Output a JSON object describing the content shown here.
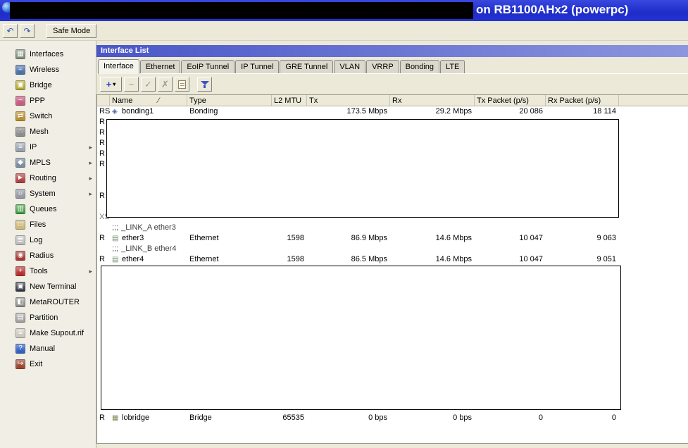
{
  "titlebar": {
    "title": "on RB1100AHx2 (powerpc)"
  },
  "toolbar": {
    "undo_label": "↶",
    "redo_label": "↷",
    "safe_mode_label": "Safe Mode"
  },
  "sidebar": {
    "items": [
      {
        "label": "Interfaces",
        "icon": "interfaces-icon",
        "glyph": "▦",
        "color": "#7E8F7E",
        "submenu": false
      },
      {
        "label": "Wireless",
        "icon": "wireless-icon",
        "glyph": "≈",
        "color": "#4A6FA8",
        "submenu": false
      },
      {
        "label": "Bridge",
        "icon": "bridge-icon",
        "glyph": "▣",
        "color": "#B5A832",
        "submenu": false
      },
      {
        "label": "PPP",
        "icon": "ppp-icon",
        "glyph": "~",
        "color": "#C55B7E",
        "submenu": false
      },
      {
        "label": "Switch",
        "icon": "switch-icon",
        "glyph": "⇄",
        "color": "#B98E2F",
        "submenu": false
      },
      {
        "label": "Mesh",
        "icon": "mesh-icon",
        "glyph": "∴",
        "color": "#8B8B8B",
        "submenu": false
      },
      {
        "label": "IP",
        "icon": "ip-icon",
        "glyph": "≡",
        "color": "#9AA4AE",
        "submenu": true
      },
      {
        "label": "MPLS",
        "icon": "mpls-icon",
        "glyph": "◆",
        "color": "#7A8BA0",
        "submenu": true
      },
      {
        "label": "Routing",
        "icon": "routing-icon",
        "glyph": "►",
        "color": "#B04040",
        "submenu": true
      },
      {
        "label": "System",
        "icon": "system-icon",
        "glyph": "☼",
        "color": "#9598A2",
        "submenu": true
      },
      {
        "label": "Queues",
        "icon": "queues-icon",
        "glyph": "▥",
        "color": "#3F9A3F",
        "submenu": false
      },
      {
        "label": "Files",
        "icon": "files-icon",
        "glyph": "□",
        "color": "#CBB878",
        "submenu": false
      },
      {
        "label": "Log",
        "icon": "log-icon",
        "glyph": "≣",
        "color": "#BDBDBD",
        "submenu": false
      },
      {
        "label": "Radius",
        "icon": "radius-icon",
        "glyph": "◉",
        "color": "#A63232",
        "submenu": false
      },
      {
        "label": "Tools",
        "icon": "tools-icon",
        "glyph": "+",
        "color": "#B53030",
        "submenu": true
      },
      {
        "label": "New Terminal",
        "icon": "new-terminal-icon",
        "glyph": "▣",
        "color": "#2F3440",
        "submenu": false
      },
      {
        "label": "MetaROUTER",
        "icon": "metarouter-icon",
        "glyph": "◧",
        "color": "#8F8F8F",
        "submenu": false
      },
      {
        "label": "Partition",
        "icon": "partition-icon",
        "glyph": "▤",
        "color": "#9E9E9E",
        "submenu": false
      },
      {
        "label": "Make Supout.rif",
        "icon": "make-supout-icon",
        "glyph": "≡",
        "color": "#C9C9BE",
        "submenu": false
      },
      {
        "label": "Manual",
        "icon": "manual-icon",
        "glyph": "?",
        "color": "#2F5FBF",
        "submenu": false
      },
      {
        "label": "Exit",
        "icon": "exit-icon",
        "glyph": "↪",
        "color": "#9C4530",
        "submenu": false
      }
    ]
  },
  "window": {
    "title": "Interface List",
    "tabs": [
      {
        "label": "Interface",
        "active": true
      },
      {
        "label": "Ethernet",
        "active": false
      },
      {
        "label": "EoIP Tunnel",
        "active": false
      },
      {
        "label": "IP Tunnel",
        "active": false
      },
      {
        "label": "GRE Tunnel",
        "active": false
      },
      {
        "label": "VLAN",
        "active": false
      },
      {
        "label": "VRRP",
        "active": false
      },
      {
        "label": "Bonding",
        "active": false
      },
      {
        "label": "LTE",
        "active": false
      }
    ],
    "action_buttons": {
      "add_label": "+",
      "add_caret": "▾",
      "remove_label": "−",
      "enable_label": "✓",
      "disable_label": "✗"
    },
    "table": {
      "columns": [
        {
          "key": "name",
          "label": "Name",
          "sort_glyph": "∕"
        },
        {
          "key": "type",
          "label": "Type"
        },
        {
          "key": "l2mtu",
          "label": "L2 MTU"
        },
        {
          "key": "tx",
          "label": "Tx"
        },
        {
          "key": "rx",
          "label": "Rx"
        },
        {
          "key": "txp",
          "label": "Tx Packet (p/s)"
        },
        {
          "key": "rxp",
          "label": "Rx Packet (p/s)"
        }
      ],
      "rows": [
        {
          "kind": "data",
          "flags": "RS",
          "name": "bonding1",
          "icon_glyph": "◈",
          "icon_color": "#4A66A0",
          "type": "Bonding",
          "l2mtu": "",
          "tx": "173.5 Mbps",
          "rx": "29.2 Mbps",
          "txp": "20 086",
          "rxp": "18 114"
        },
        {
          "kind": "redacted",
          "variant": 1,
          "flag_rows": [
            "R",
            "R",
            "R",
            "R",
            "R",
            "",
            "",
            "R",
            "",
            "XS"
          ]
        },
        {
          "kind": "comment",
          "marker": ";;;",
          "text": "_LINK_A ether3"
        },
        {
          "kind": "data",
          "flags": "R",
          "name": "ether3",
          "icon_glyph": "▤",
          "icon_color": "#6A8A6A",
          "type": "Ethernet",
          "l2mtu": "1598",
          "tx": "86.9 Mbps",
          "rx": "14.6 Mbps",
          "txp": "10 047",
          "rxp": "9 063"
        },
        {
          "kind": "comment",
          "marker": ";;;",
          "text": "_LINK_B ether4"
        },
        {
          "kind": "data",
          "flags": "R",
          "name": "ether4",
          "icon_glyph": "▤",
          "icon_color": "#6A8A6A",
          "type": "Ethernet",
          "l2mtu": "1598",
          "tx": "86.5 Mbps",
          "rx": "14.6 Mbps",
          "txp": "10 047",
          "rxp": "9 051"
        },
        {
          "kind": "redacted",
          "variant": 2,
          "flag_rows": [
            "",
            "",
            "",
            "",
            "",
            "",
            "",
            "",
            "",
            "",
            "",
            "",
            "",
            ""
          ]
        },
        {
          "kind": "data",
          "flags": "R",
          "name": "lobridge",
          "icon_glyph": "▦",
          "icon_color": "#8A8A5A",
          "type": "Bridge",
          "l2mtu": "65535",
          "tx": "0 bps",
          "rx": "0 bps",
          "txp": "0",
          "rxp": "0"
        }
      ]
    }
  }
}
